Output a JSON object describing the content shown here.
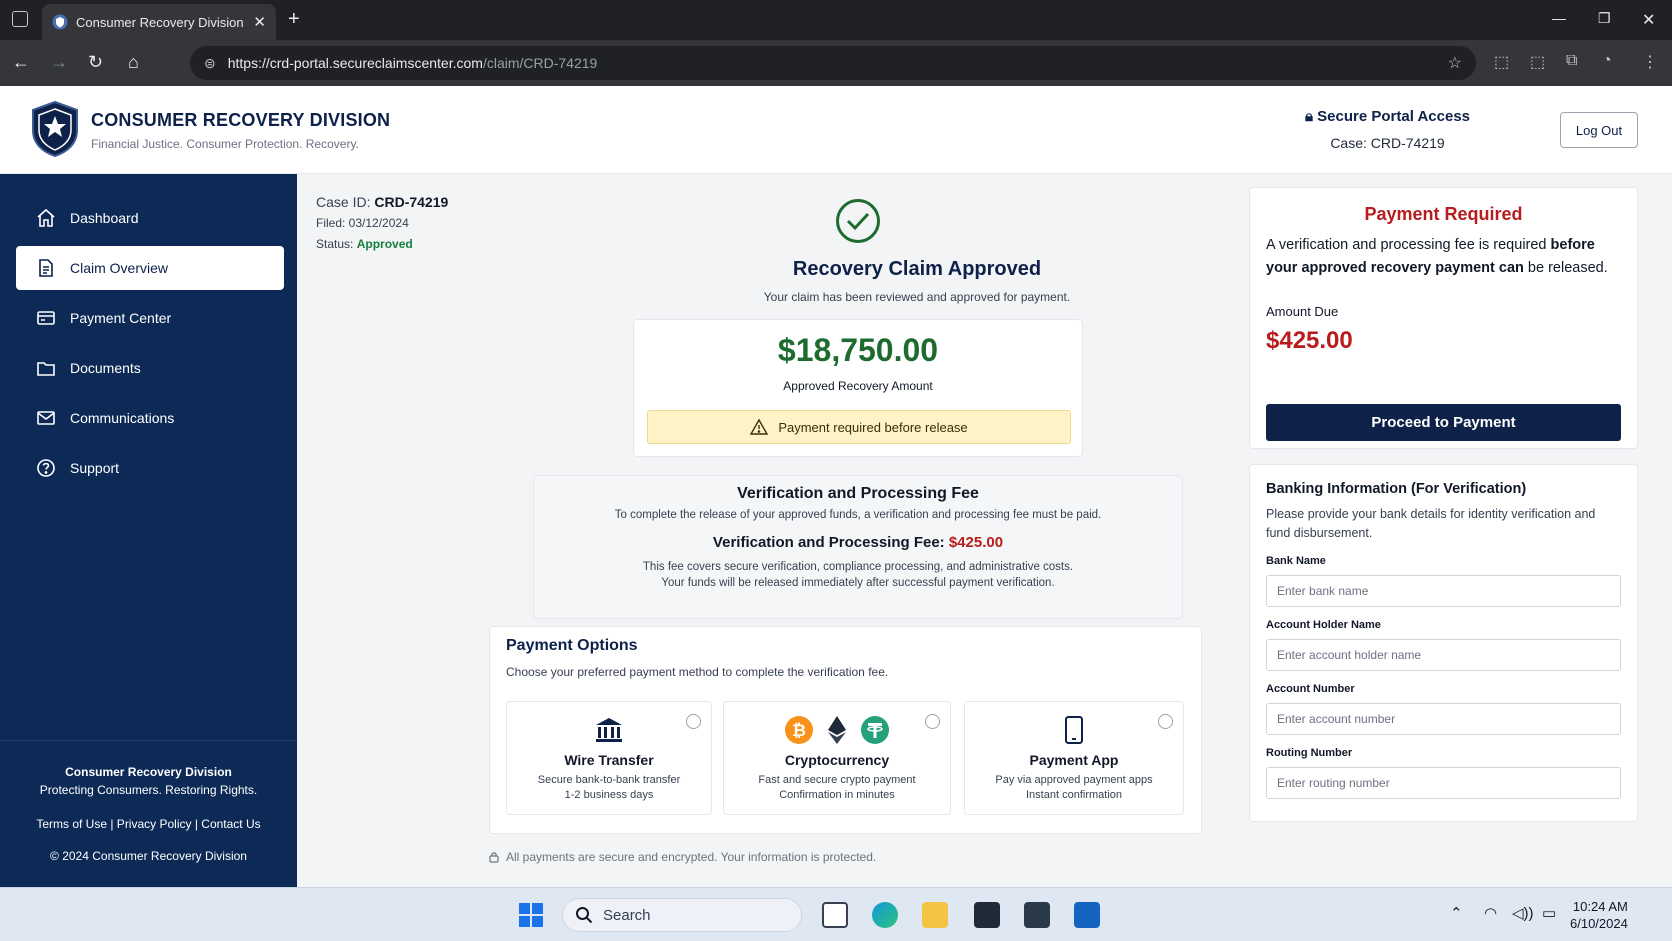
{
  "browser": {
    "tab_title": "Consumer Recovery Division",
    "url_host": "https://crd-portal.secureclaimscenter.com",
    "url_path": "/claim/CRD-74219"
  },
  "header": {
    "org_name": "CONSUMER RECOVERY DIVISION",
    "tagline": "Financial Justice. Consumer Protection. Recovery.",
    "secure_label": "Secure Portal Access",
    "case_label": "Case: CRD-74219",
    "logout_label": "Log Out"
  },
  "sidebar": {
    "items": [
      {
        "label": "Dashboard",
        "icon": "home-icon"
      },
      {
        "label": "Claim Overview",
        "icon": "document-icon"
      },
      {
        "label": "Payment Center",
        "icon": "credit-card-icon"
      },
      {
        "label": "Documents",
        "icon": "folder-icon"
      },
      {
        "label": "Communications",
        "icon": "mail-icon"
      },
      {
        "label": "Support",
        "icon": "help-icon"
      }
    ],
    "footer_name": "Consumer Recovery Division",
    "footer_slogan": "Protecting Consumers. Restoring Rights.",
    "footer_links": "Terms of Use | Privacy Policy | Contact Us",
    "footer_copyright": "© 2024 Consumer Recovery Division"
  },
  "case": {
    "id_label": "Case ID:",
    "id_value": "CRD-74219",
    "filed": "Filed: 03/12/2024",
    "status_label": "Status:",
    "status_value": "Approved"
  },
  "claim": {
    "title": "Recovery Claim Approved",
    "subtitle": "Your claim has been reviewed and approved for payment.",
    "amount": "$18,750.00",
    "amount_label": "Approved Recovery Amount",
    "warning": "Payment required before release"
  },
  "fee": {
    "heading": "Verification and Processing Fee",
    "description": "To complete the release of your approved funds, a verification and processing fee must be paid.",
    "fee_label": "Verification and Processing Fee:",
    "fee_value": "$425.00",
    "note1": "This fee covers secure verification, compliance processing, and administrative costs.",
    "note2": "Your funds will be released immediately after successful payment verification."
  },
  "payment_options": {
    "heading": "Payment Options",
    "subtitle": "Choose your preferred payment method to complete the verification fee.",
    "options": [
      {
        "title": "Wire Transfer",
        "line1": "Secure bank-to-bank transfer",
        "line2": "1-2 business days"
      },
      {
        "title": "Cryptocurrency",
        "line1": "Fast and secure crypto payment",
        "line2": "Confirmation in minutes"
      },
      {
        "title": "Payment App",
        "line1": "Pay via approved payment apps",
        "line2": "Instant confirmation"
      }
    ],
    "security_note": "All payments are secure and encrypted. Your information is protected."
  },
  "payment_required": {
    "heading": "Payment Required",
    "text_normal": "A verification and processing fee is required ",
    "text_bold": "before your approved recovery payment can",
    "text_end": " be released.",
    "amount_due_label": "Amount Due",
    "amount_due": "$425.00",
    "button": "Proceed to Payment"
  },
  "banking": {
    "heading": "Banking Information (For Verification)",
    "description": "Please provide your bank details for identity verification and fund disbursement.",
    "fields": [
      {
        "label": "Bank Name",
        "placeholder": "Enter bank name",
        "value": ""
      },
      {
        "label": "Account Holder Name",
        "placeholder": "Enter account holder name",
        "value": ""
      },
      {
        "label": "Account Number",
        "placeholder": "Enter account number",
        "value": ""
      },
      {
        "label": "Routing Number",
        "placeholder": "Enter routing number",
        "value": ""
      }
    ]
  },
  "taskbar": {
    "search": "Search",
    "time": "10:24 AM",
    "date": "6/10/2024"
  },
  "colors": {
    "navy": "#0d2149",
    "sidebar": "#0d2a57",
    "success": "#1e6b2f",
    "danger": "#b91c1c",
    "warning_bg": "#fdf3c7"
  }
}
